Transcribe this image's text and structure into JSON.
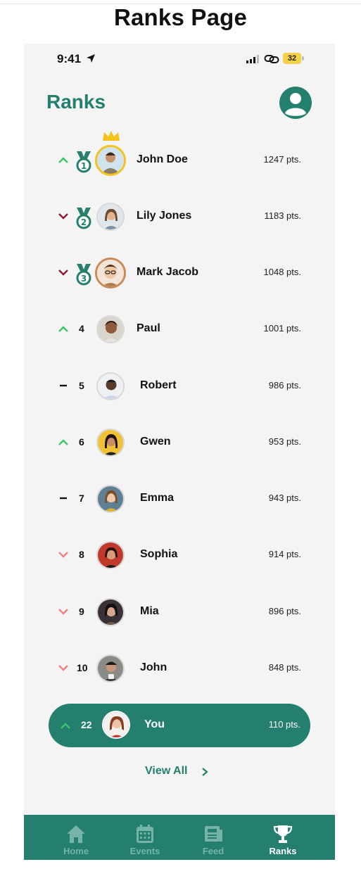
{
  "page_heading": "Ranks Page",
  "status_bar": {
    "time": "9:41",
    "battery": "32"
  },
  "screen_title": "Ranks",
  "colors": {
    "brand": "#247f6e",
    "trend_up": "#3cc46c",
    "trend_down_dark": "#8b1d2a",
    "trend_down_light": "#f08080",
    "gold": "#f3c21b"
  },
  "ranks": [
    {
      "rank": "1",
      "name": "John Doe",
      "points": "1247 pts.",
      "trend": "up",
      "medal": "gold-medal",
      "avatar": "avatar-john-doe"
    },
    {
      "rank": "2",
      "name": "Lily Jones",
      "points": "1183 pts.",
      "trend": "down",
      "medal": "silver-medal",
      "avatar": "avatar-lily-jones"
    },
    {
      "rank": "3",
      "name": "Mark Jacob",
      "points": "1048 pts.",
      "trend": "down",
      "medal": "bronze-medal",
      "avatar": "avatar-mark-jacob"
    },
    {
      "rank": "4",
      "name": "Paul",
      "points": "1001 pts.",
      "trend": "up"
    },
    {
      "rank": "5",
      "name": "Robert",
      "points": "986 pts.",
      "trend": "same"
    },
    {
      "rank": "6",
      "name": "Gwen",
      "points": "953 pts.",
      "trend": "up"
    },
    {
      "rank": "7",
      "name": "Emma",
      "points": "943 pts.",
      "trend": "same"
    },
    {
      "rank": "8",
      "name": "Sophia",
      "points": "914 pts.",
      "trend": "down"
    },
    {
      "rank": "9",
      "name": "Mia",
      "points": "896 pts.",
      "trend": "down"
    },
    {
      "rank": "10",
      "name": "John",
      "points": "848 pts.",
      "trend": "down"
    }
  ],
  "current_user": {
    "rank": "22",
    "name": "You",
    "points": "110 pts.",
    "trend": "up"
  },
  "view_all_label": "View All",
  "tabs": [
    {
      "label": "Home",
      "icon": "home-icon"
    },
    {
      "label": "Events",
      "icon": "calendar-icon"
    },
    {
      "label": "Feed",
      "icon": "newspaper-icon"
    },
    {
      "label": "Ranks",
      "icon": "trophy-icon",
      "active": true
    }
  ]
}
